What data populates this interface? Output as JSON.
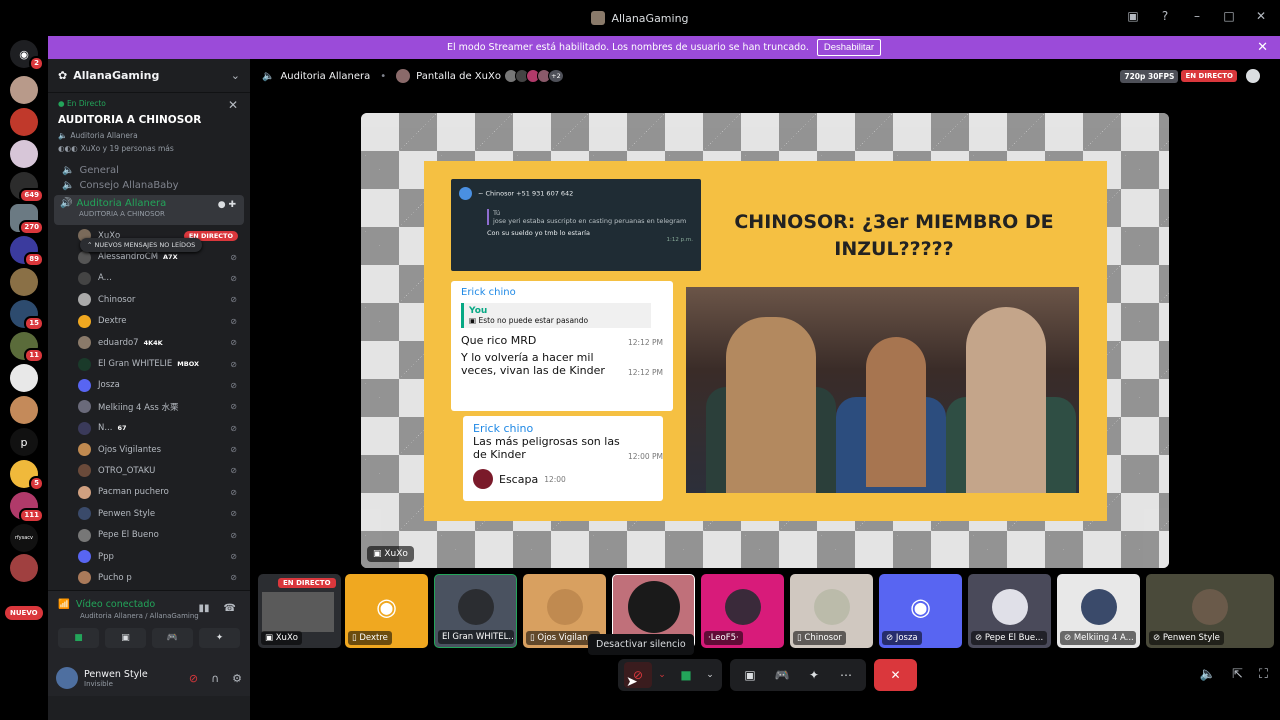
{
  "window": {
    "title": "AllanaGaming"
  },
  "banner": {
    "text": "El modo Streamer está habilitado. Los nombres de usuario se han truncado.",
    "button": "Deshabilitar"
  },
  "guild_badges": {
    "g1": "2",
    "g5": "649",
    "g6": "270",
    "g7": "89",
    "g9": "15",
    "g10": "11",
    "g13": "p",
    "g14": "5",
    "g15": "111",
    "g16": "rfysacv",
    "nuevo": "NUEVO"
  },
  "sidebar": {
    "server_name": "AllanaGaming",
    "event": {
      "live": "En Directo",
      "title": "AUDITORIA A CHINOSOR",
      "channel": "Auditoria Allanera",
      "people": "XuXo y 19 personas más"
    },
    "channels": [
      "General",
      "Consejo AllanaBaby"
    ],
    "new_messages": "NUEVOS MENSAJES NO LEÍDOS",
    "active_channel": {
      "name": "Auditoria Allanera",
      "status": "AUDITORIA A CHINOSOR"
    },
    "voice_users": [
      {
        "name": "XuXo",
        "tag": "",
        "live": "EN DIRECTO"
      },
      {
        "name": "AlessandroCM",
        "tag": "A7X"
      },
      {
        "name": "A...",
        "tag": ""
      },
      {
        "name": "Chinosor",
        "tag": ""
      },
      {
        "name": "Dextre",
        "tag": ""
      },
      {
        "name": "eduardo7",
        "tag": "4K4K"
      },
      {
        "name": "El Gran WHITELIE",
        "tag": "MBOX"
      },
      {
        "name": "Josza",
        "tag": ""
      },
      {
        "name": "Melkiing 4 Ass 水栗",
        "tag": ""
      },
      {
        "name": "N...",
        "tag": "67"
      },
      {
        "name": "Ojos Vigilantes",
        "tag": ""
      },
      {
        "name": "OTRO_OTAKU",
        "tag": ""
      },
      {
        "name": "Pacman puchero",
        "tag": ""
      },
      {
        "name": "Penwen Style",
        "tag": ""
      },
      {
        "name": "Pepe El Bueno",
        "tag": ""
      },
      {
        "name": "Ppp",
        "tag": ""
      },
      {
        "name": "Pucho p",
        "tag": ""
      }
    ]
  },
  "voice_panel": {
    "status": "Vídeo conectado",
    "location": "Auditoria Allanera / AllanaGaming"
  },
  "user_panel": {
    "name": "Penwen Style",
    "status": "Invisible"
  },
  "stage": {
    "channel": "Auditoria Allanera",
    "screen": "Pantalla de XuXo",
    "extra": "+2",
    "quality": "720p 30FPS",
    "live": "EN DIRECTO"
  },
  "stream": {
    "label": "XuXo",
    "slide_title": "CHINOSOR: ¿3er MIEMBRO DE INZUL?????",
    "chat1": {
      "header": "~ Chinosor +51 931 607 642",
      "quote_name": "Tú",
      "quote": "jose yeri estaba suscripto en casting peruanas en telegram",
      "text": "Con su sueldo yo tmb lo estaría",
      "time": "1:12 p.m."
    },
    "chat2": {
      "name": "Erick chino",
      "reply_name": "You",
      "reply_text": "Esto no puede estar pasando",
      "m1": "Que rico MRD",
      "t1": "12:12 PM",
      "m2": "Y lo volvería a hacer mil veces, vivan las de Kinder",
      "t2": "12:12 PM"
    },
    "chat3": {
      "name": "Erick chino",
      "m1": "Las más peligrosas son las de Kinder",
      "t1": "12:00 PM",
      "m2": "Escapa",
      "t2": "12:00"
    }
  },
  "tiles": [
    {
      "name": "XuXo",
      "live": "EN DIRECTO"
    },
    {
      "name": "Dextre"
    },
    {
      "name": "El Gran WHITEL..."
    },
    {
      "name": "Ojos Vigilan..."
    },
    {
      "name": ""
    },
    {
      "name": "·LeoF5·"
    },
    {
      "name": "Chinosor"
    },
    {
      "name": "Josza"
    },
    {
      "name": "Pepe El Bue..."
    },
    {
      "name": "Melkiing 4 A..."
    },
    {
      "name": "Penwen Style"
    }
  ],
  "tooltip": "Desactivar silencio",
  "colors": {
    "accent_purple": "#9b4bd9",
    "live_red": "#da373c",
    "green": "#23a55a",
    "slide_yellow": "#f5c042"
  }
}
